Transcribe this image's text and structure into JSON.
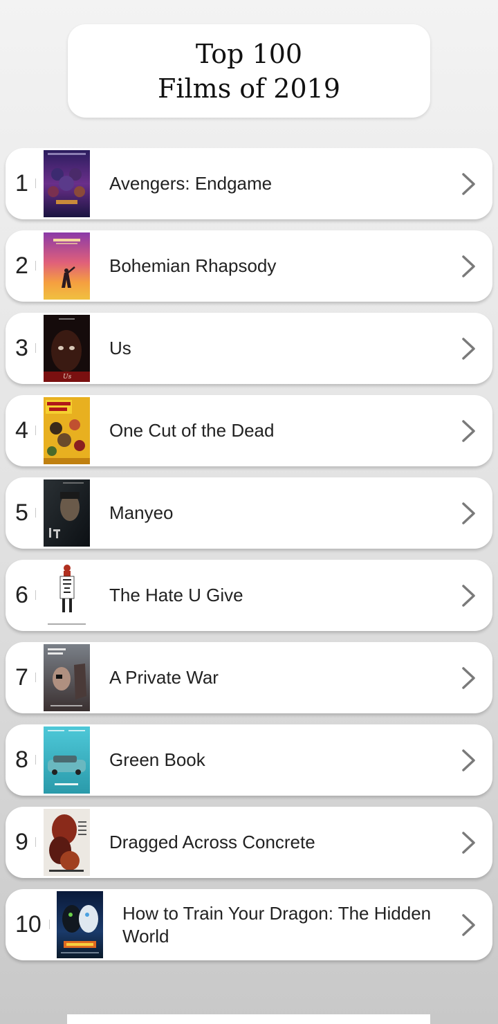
{
  "header": {
    "title_line1": "Top 100",
    "title_line2": "Films of 2019"
  },
  "films": [
    {
      "rank": "1",
      "title": "Avengers: Endgame"
    },
    {
      "rank": "2",
      "title": "Bohemian Rhapsody"
    },
    {
      "rank": "3",
      "title": "Us"
    },
    {
      "rank": "4",
      "title": "One Cut of the Dead"
    },
    {
      "rank": "5",
      "title": "Manyeo"
    },
    {
      "rank": "6",
      "title": "The Hate U Give"
    },
    {
      "rank": "7",
      "title": "A Private War"
    },
    {
      "rank": "8",
      "title": "Green Book"
    },
    {
      "rank": "9",
      "title": "Dragged Across Concrete"
    },
    {
      "rank": "10",
      "title": "How to Train Your Dragon: The Hidden World"
    }
  ],
  "icons": {
    "row_chevron": "chevron-right-icon"
  },
  "colors": {
    "card": "#ffffff",
    "text": "#222222",
    "chevron": "#7a7a7a"
  }
}
